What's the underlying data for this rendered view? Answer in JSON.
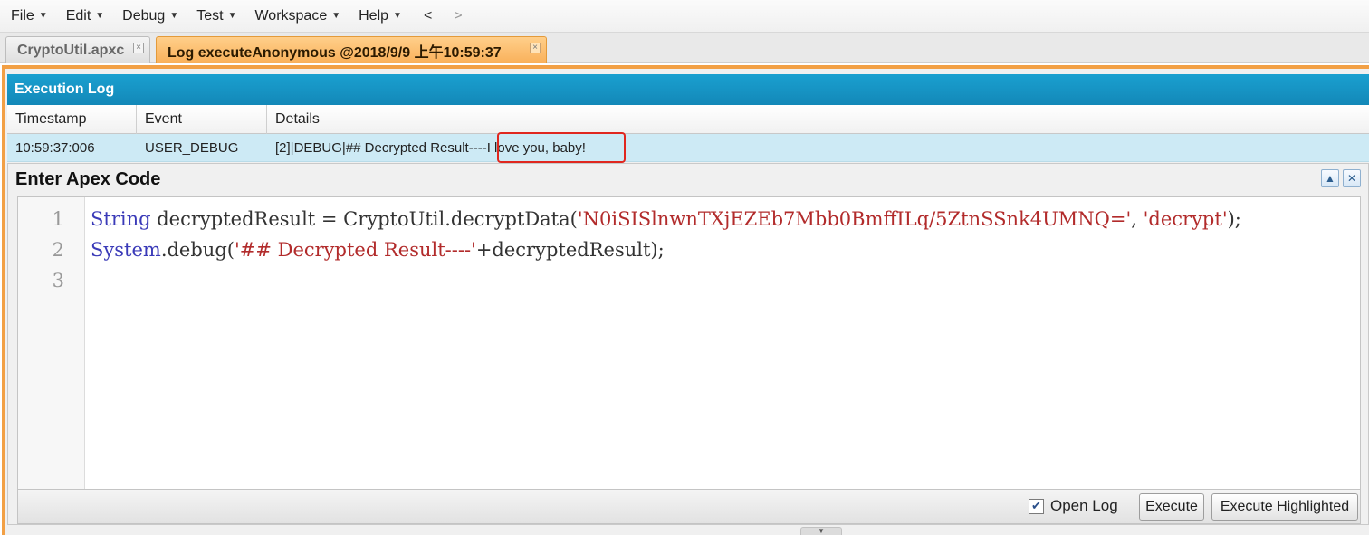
{
  "menu": {
    "items": [
      "File",
      "Edit",
      "Debug",
      "Test",
      "Workspace",
      "Help"
    ],
    "back": "<",
    "forward": ">"
  },
  "tabs": [
    {
      "label": "CryptoUtil.apxc",
      "active": false,
      "close": "×"
    },
    {
      "label": "Log executeAnonymous @2018/9/9 上午10:59:37",
      "active": true,
      "close": "×"
    }
  ],
  "execution_log": {
    "title": "Execution Log",
    "columns": [
      "Timestamp",
      "Event",
      "Details"
    ],
    "rows": [
      {
        "timestamp": "10:59:37:006",
        "event": "USER_DEBUG",
        "details": "[2]|DEBUG|## Decrypted Result----I love you, baby!"
      }
    ]
  },
  "apex_panel": {
    "title": "Enter Apex Code",
    "minimize_icon": "▲",
    "close_icon": "✕",
    "line_numbers": [
      "1",
      "2",
      "3"
    ],
    "code": {
      "line1": {
        "keyword": "String",
        "plain1": " decryptedResult = CryptoUtil.decryptData(",
        "string1": "'N0iSISlnwnTXjEZEb7Mbb0BmffILq/5ZtnSSnk4UMNQ='",
        "plain2": ", ",
        "string2": "'decrypt'",
        "plain3": ");"
      },
      "line2": {
        "keyword": "System",
        "plain1": ".debug(",
        "string1": "'## Decrypted Result----'",
        "plain2": "+decryptedResult);"
      },
      "line3": ""
    },
    "open_log_label": "Open Log",
    "open_log_checked": true,
    "check_mark": "✔",
    "execute_label": "Execute",
    "execute_highlighted_label": "Execute Highlighted"
  },
  "colors": {
    "log_header": "#1388b8",
    "active_tab": "#f9b05a",
    "highlight_border": "#e0271f",
    "keyword": "#3a3ab8",
    "string": "#b22b2b"
  }
}
